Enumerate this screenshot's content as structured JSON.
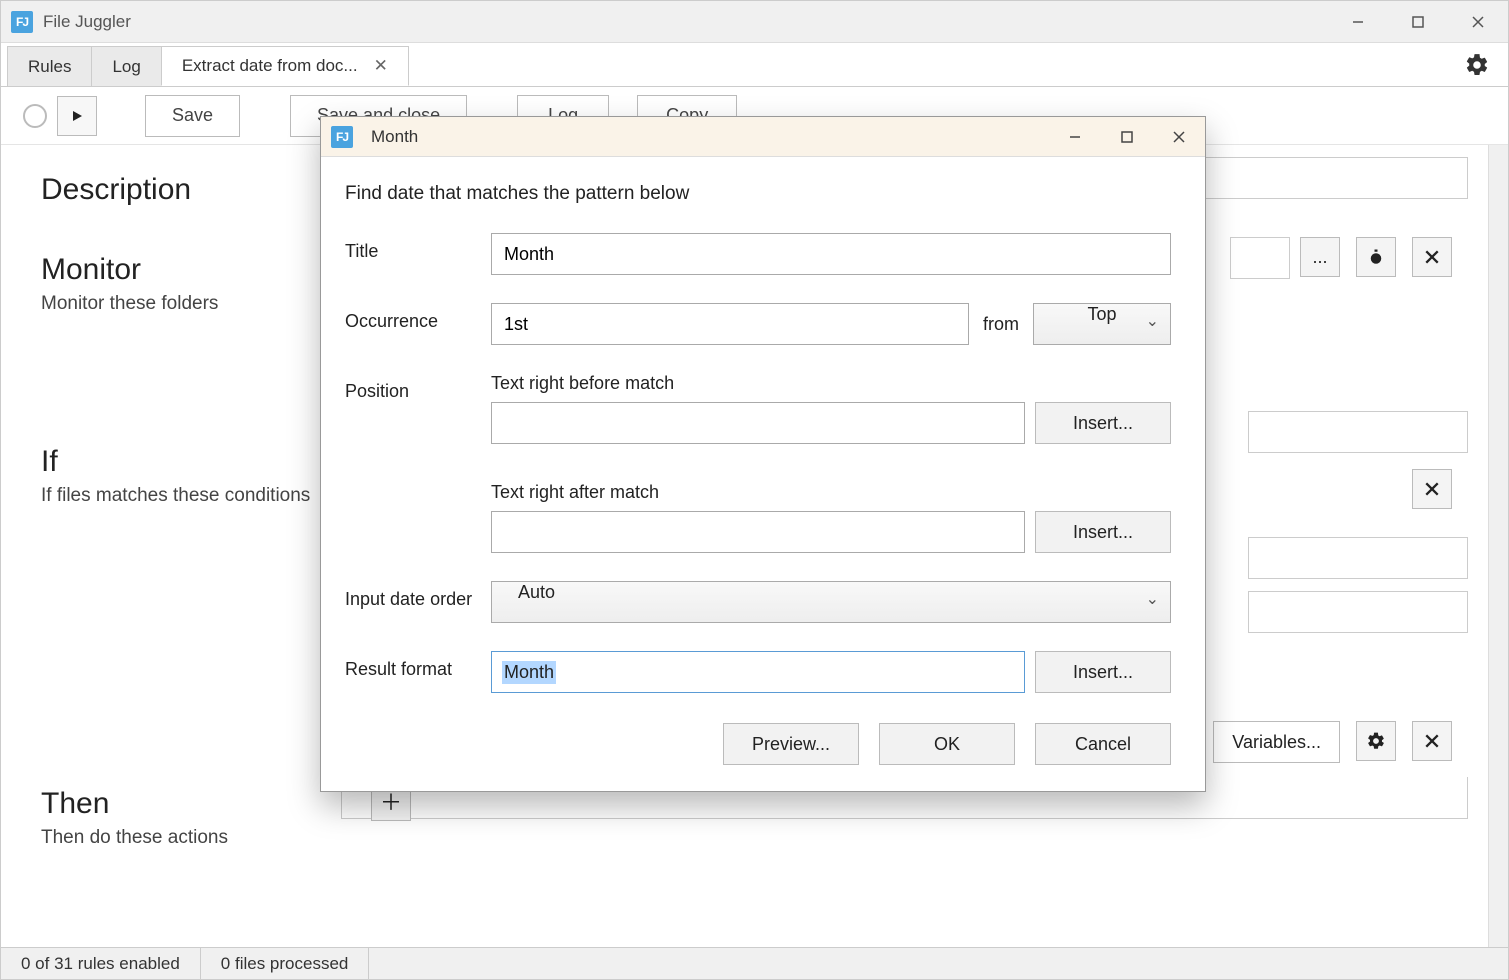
{
  "app": {
    "title": "File Juggler"
  },
  "tabs": [
    {
      "label": "Rules"
    },
    {
      "label": "Log"
    },
    {
      "label": "Extract date from doc..."
    }
  ],
  "toolbar": {
    "save": "Save",
    "save_close": "Save and close",
    "log": "Log",
    "copy": "Copy"
  },
  "sections": {
    "description": {
      "title": "Description"
    },
    "monitor": {
      "title": "Monitor",
      "sub": "Monitor these folders"
    },
    "if": {
      "title": "If",
      "sub": "If files matches these conditions"
    },
    "then": {
      "title": "Then",
      "sub": "Then do these actions"
    }
  },
  "bg_buttons": {
    "ellipsis": "...",
    "variables": "Variables..."
  },
  "statusbar": {
    "rules": "0 of 31 rules enabled",
    "files": "0 files processed"
  },
  "dialog": {
    "title": "Month",
    "description": "Find date that matches the pattern below",
    "labels": {
      "title": "Title",
      "occurrence": "Occurrence",
      "from": "from",
      "position": "Position",
      "text_before": "Text right before match",
      "text_after": "Text right after match",
      "input_date_order": "Input date order",
      "result_format": "Result format"
    },
    "values": {
      "title": "Month",
      "occurrence": "1st",
      "from": "Top",
      "text_before": "",
      "text_after": "",
      "input_date_order": "Auto",
      "result_format": "Month"
    },
    "buttons": {
      "insert": "Insert...",
      "preview": "Preview...",
      "ok": "OK",
      "cancel": "Cancel"
    }
  }
}
